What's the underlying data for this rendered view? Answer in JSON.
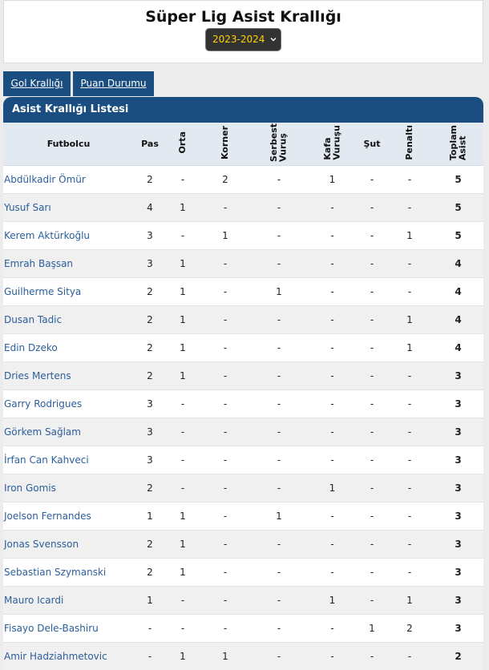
{
  "header": {
    "title": "Süper Lig Asist Krallığı",
    "season": "2023-2024"
  },
  "tabs": [
    {
      "label": "Gol Krallığı"
    },
    {
      "label": "Puan Durumu"
    }
  ],
  "panel": {
    "title": "Asist Krallığı Listesi"
  },
  "columns": {
    "player": "Futbolcu",
    "pas": "Pas",
    "orta": "Orta",
    "korner": "Korner",
    "serbest": "Serbest\nVuruş",
    "kafa": "Kafa\nVuruşu",
    "sut": "Şut",
    "penalti": "Penaltı",
    "toplam": "Toplam\nAsist"
  },
  "rows": [
    {
      "name": "Abdülkadir Ömür",
      "pas": "2",
      "orta": "-",
      "korner": "2",
      "serbest": "-",
      "kafa": "1",
      "sut": "-",
      "penalti": "-",
      "toplam": "5"
    },
    {
      "name": "Yusuf Sarı",
      "pas": "4",
      "orta": "1",
      "korner": "-",
      "serbest": "-",
      "kafa": "-",
      "sut": "-",
      "penalti": "-",
      "toplam": "5"
    },
    {
      "name": "Kerem Aktürkoğlu",
      "pas": "3",
      "orta": "-",
      "korner": "1",
      "serbest": "-",
      "kafa": "-",
      "sut": "-",
      "penalti": "1",
      "toplam": "5"
    },
    {
      "name": "Emrah Başsan",
      "pas": "3",
      "orta": "1",
      "korner": "-",
      "serbest": "-",
      "kafa": "-",
      "sut": "-",
      "penalti": "-",
      "toplam": "4"
    },
    {
      "name": "Guilherme Sitya",
      "pas": "2",
      "orta": "1",
      "korner": "-",
      "serbest": "1",
      "kafa": "-",
      "sut": "-",
      "penalti": "-",
      "toplam": "4"
    },
    {
      "name": "Dusan Tadic",
      "pas": "2",
      "orta": "1",
      "korner": "-",
      "serbest": "-",
      "kafa": "-",
      "sut": "-",
      "penalti": "1",
      "toplam": "4"
    },
    {
      "name": "Edin Dzeko",
      "pas": "2",
      "orta": "1",
      "korner": "-",
      "serbest": "-",
      "kafa": "-",
      "sut": "-",
      "penalti": "1",
      "toplam": "4"
    },
    {
      "name": "Dries Mertens",
      "pas": "2",
      "orta": "1",
      "korner": "-",
      "serbest": "-",
      "kafa": "-",
      "sut": "-",
      "penalti": "-",
      "toplam": "3"
    },
    {
      "name": "Garry Rodrigues",
      "pas": "3",
      "orta": "-",
      "korner": "-",
      "serbest": "-",
      "kafa": "-",
      "sut": "-",
      "penalti": "-",
      "toplam": "3"
    },
    {
      "name": "Görkem Sağlam",
      "pas": "3",
      "orta": "-",
      "korner": "-",
      "serbest": "-",
      "kafa": "-",
      "sut": "-",
      "penalti": "-",
      "toplam": "3"
    },
    {
      "name": "İrfan Can Kahveci",
      "pas": "3",
      "orta": "-",
      "korner": "-",
      "serbest": "-",
      "kafa": "-",
      "sut": "-",
      "penalti": "-",
      "toplam": "3"
    },
    {
      "name": "Iron Gomis",
      "pas": "2",
      "orta": "-",
      "korner": "-",
      "serbest": "-",
      "kafa": "1",
      "sut": "-",
      "penalti": "-",
      "toplam": "3"
    },
    {
      "name": "Joelson Fernandes",
      "pas": "1",
      "orta": "1",
      "korner": "-",
      "serbest": "1",
      "kafa": "-",
      "sut": "-",
      "penalti": "-",
      "toplam": "3"
    },
    {
      "name": "Jonas Svensson",
      "pas": "2",
      "orta": "1",
      "korner": "-",
      "serbest": "-",
      "kafa": "-",
      "sut": "-",
      "penalti": "-",
      "toplam": "3"
    },
    {
      "name": "Sebastian Szymanski",
      "pas": "2",
      "orta": "1",
      "korner": "-",
      "serbest": "-",
      "kafa": "-",
      "sut": "-",
      "penalti": "-",
      "toplam": "3"
    },
    {
      "name": "Mauro Icardi",
      "pas": "1",
      "orta": "-",
      "korner": "-",
      "serbest": "-",
      "kafa": "1",
      "sut": "-",
      "penalti": "1",
      "toplam": "3"
    },
    {
      "name": "Fisayo Dele-Bashiru",
      "pas": "-",
      "orta": "-",
      "korner": "-",
      "serbest": "-",
      "kafa": "-",
      "sut": "1",
      "penalti": "2",
      "toplam": "3"
    },
    {
      "name": "Amir Hadziahmetovic",
      "pas": "-",
      "orta": "1",
      "korner": "1",
      "serbest": "-",
      "kafa": "-",
      "sut": "-",
      "penalti": "-",
      "toplam": "2"
    }
  ]
}
